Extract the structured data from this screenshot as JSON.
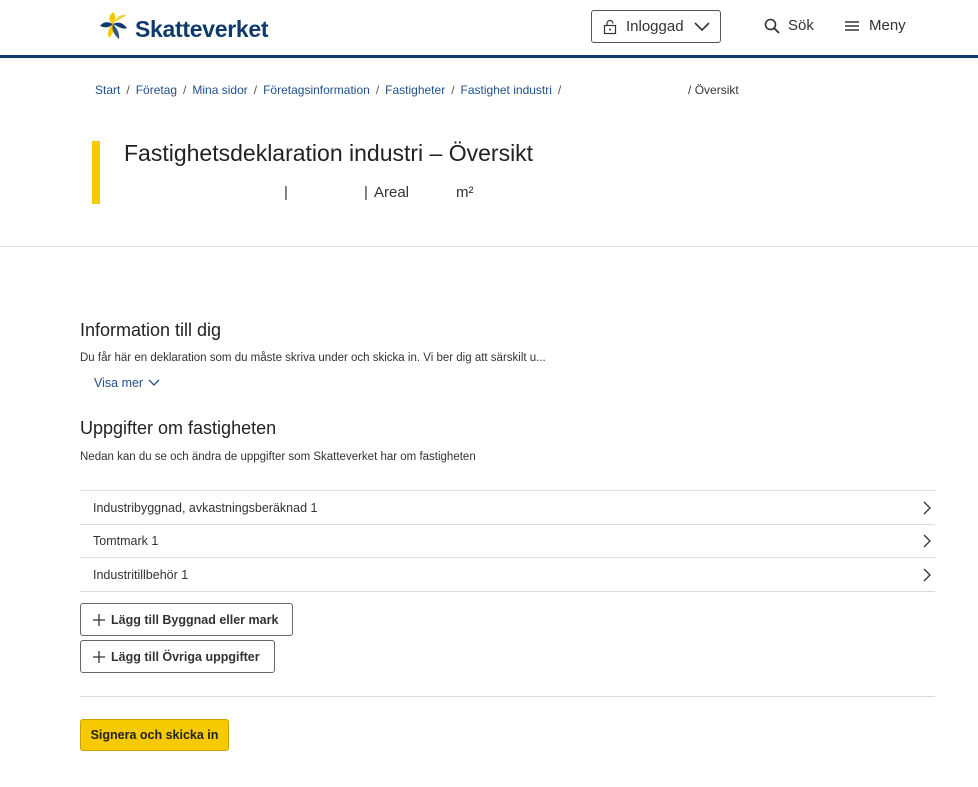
{
  "header": {
    "logo_text": "Skatteverket",
    "login_label": "Inloggad",
    "search_label": "Sök",
    "menu_label": "Meny"
  },
  "breadcrumb": {
    "items": [
      "Start",
      "Företag",
      "Mina sidor",
      "Företagsinformation",
      "Fastigheter",
      "Fastighet industri"
    ],
    "separator": "/",
    "current": "Översikt"
  },
  "page": {
    "title": "Fastighetsdeklaration industri – Översikt",
    "subtitle_pipe": "|",
    "subtitle_areal": "Areal",
    "subtitle_unit": "m²"
  },
  "info_section": {
    "heading": "Information till dig",
    "text": "Du får här en deklaration som du måste skriva under och skicka in. Vi ber dig att särskilt u...",
    "show_more": "Visa mer"
  },
  "property_section": {
    "heading": "Uppgifter om fastigheten",
    "text": "Nedan kan du se och ändra de uppgifter som Skatteverket har om fastigheten",
    "items": [
      "Industribyggnad, avkastningsberäknad 1",
      "Tomtmark 1",
      "Industritillbehör 1"
    ]
  },
  "actions": {
    "add_building": "Lägg till Byggnad eller mark",
    "add_other": "Lägg till Övriga uppgifter",
    "sign_submit": "Signera och skicka in"
  },
  "colors": {
    "brand_blue": "#0f3a6b",
    "accent_yellow": "#f7c900",
    "link_blue": "#1f4f8c"
  }
}
